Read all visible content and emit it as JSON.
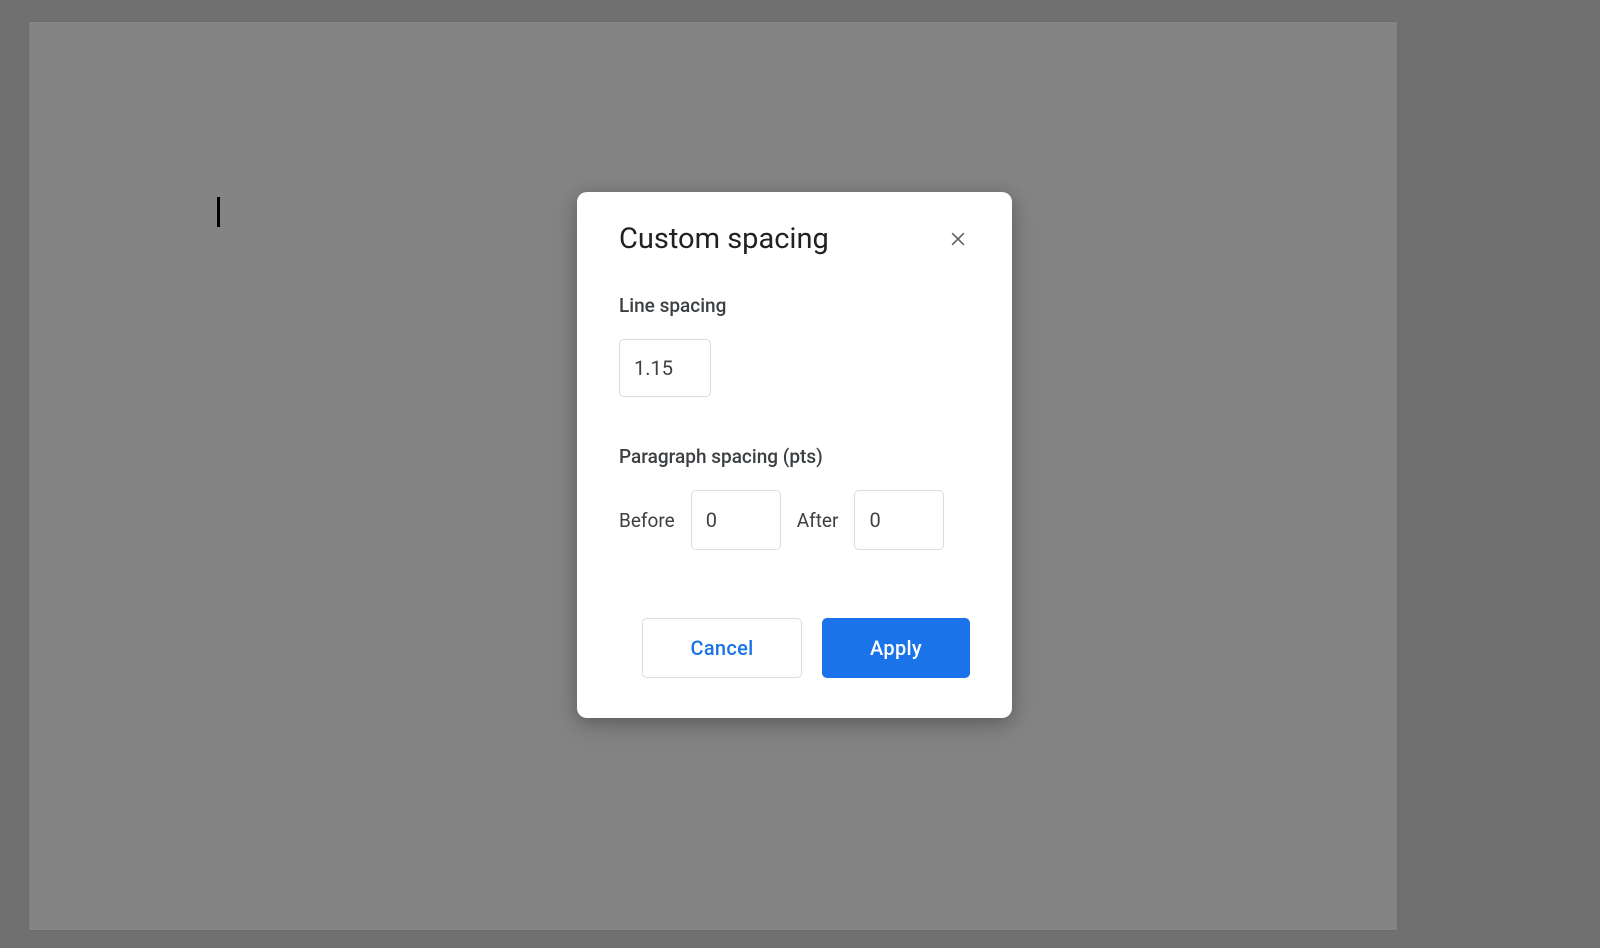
{
  "dialog": {
    "title": "Custom spacing",
    "line_spacing": {
      "label": "Line spacing",
      "value": "1.15"
    },
    "paragraph_spacing": {
      "label": "Paragraph spacing (pts)",
      "before_label": "Before",
      "before_value": "0",
      "after_label": "After",
      "after_value": "0"
    },
    "buttons": {
      "cancel": "Cancel",
      "apply": "Apply"
    }
  }
}
